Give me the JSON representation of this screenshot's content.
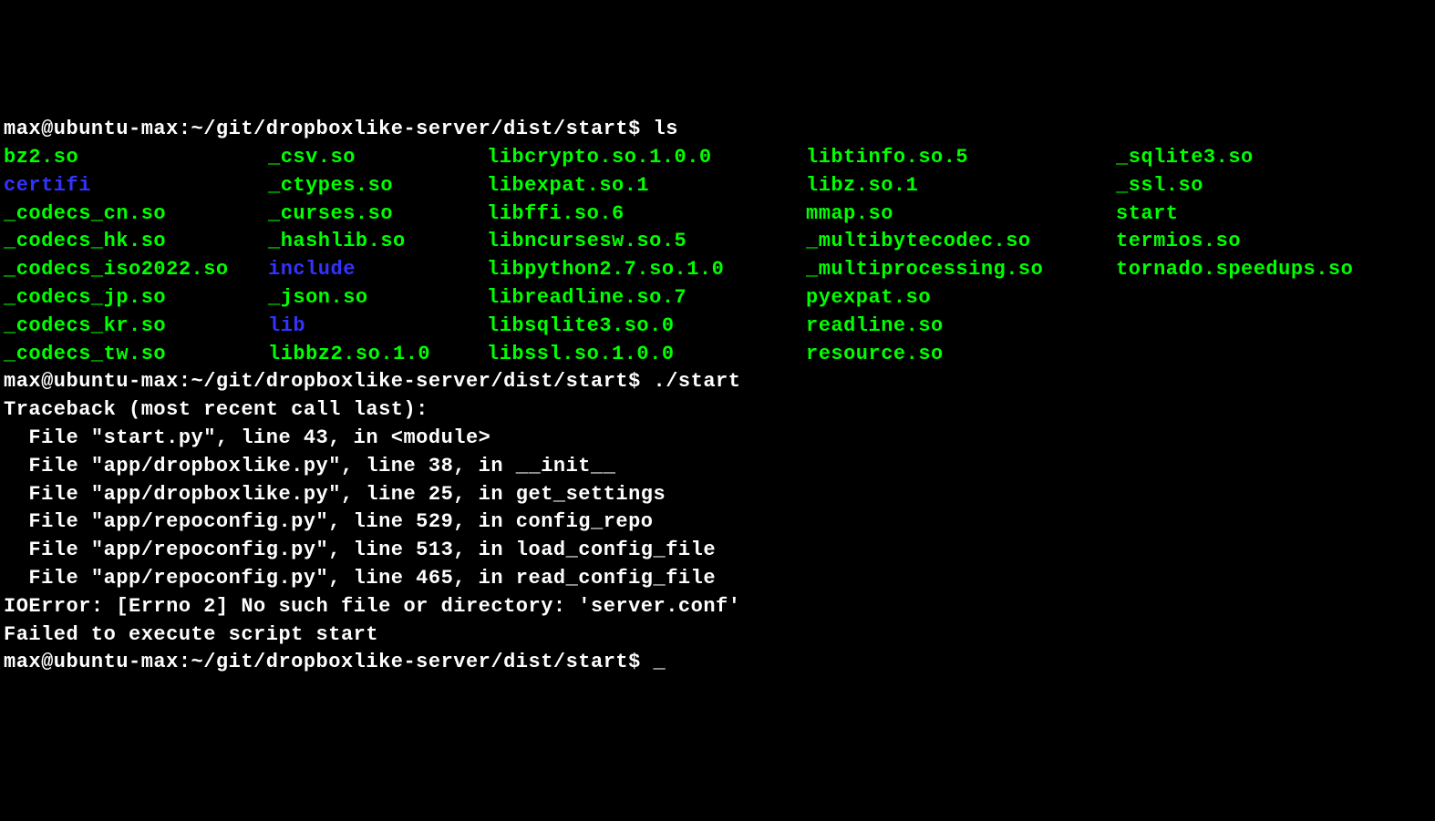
{
  "prompts": {
    "p1_prefix": "max@ubuntu-max:~/git/dropboxlike-server/dist/start$ ",
    "p1_cmd": "ls",
    "p2_prefix": "max@ubuntu-max:~/git/dropboxlike-server/dist/start$ ",
    "p2_cmd": "./start",
    "p3_prefix": "max@ubuntu-max:~/git/dropboxlike-server/dist/start$ "
  },
  "ls": {
    "rows": [
      [
        {
          "name": "bz2.so",
          "type": "file"
        },
        {
          "name": "_csv.so",
          "type": "file"
        },
        {
          "name": "libcrypto.so.1.0.0",
          "type": "file"
        },
        {
          "name": "libtinfo.so.5",
          "type": "file"
        },
        {
          "name": "_sqlite3.so",
          "type": "file"
        }
      ],
      [
        {
          "name": "certifi",
          "type": "dir"
        },
        {
          "name": "_ctypes.so",
          "type": "file"
        },
        {
          "name": "libexpat.so.1",
          "type": "file"
        },
        {
          "name": "libz.so.1",
          "type": "file"
        },
        {
          "name": "_ssl.so",
          "type": "file"
        }
      ],
      [
        {
          "name": "_codecs_cn.so",
          "type": "file"
        },
        {
          "name": "_curses.so",
          "type": "file"
        },
        {
          "name": "libffi.so.6",
          "type": "file"
        },
        {
          "name": "mmap.so",
          "type": "file"
        },
        {
          "name": "start",
          "type": "file"
        }
      ],
      [
        {
          "name": "_codecs_hk.so",
          "type": "file"
        },
        {
          "name": "_hashlib.so",
          "type": "file"
        },
        {
          "name": "libncursesw.so.5",
          "type": "file"
        },
        {
          "name": "_multibytecodec.so",
          "type": "file"
        },
        {
          "name": "termios.so",
          "type": "file"
        }
      ],
      [
        {
          "name": "_codecs_iso2022.so",
          "type": "file"
        },
        {
          "name": "include",
          "type": "dir"
        },
        {
          "name": "libpython2.7.so.1.0",
          "type": "file"
        },
        {
          "name": "_multiprocessing.so",
          "type": "file"
        },
        {
          "name": "tornado.speedups.so",
          "type": "file"
        }
      ],
      [
        {
          "name": "_codecs_jp.so",
          "type": "file"
        },
        {
          "name": "_json.so",
          "type": "file"
        },
        {
          "name": "libreadline.so.7",
          "type": "file"
        },
        {
          "name": "pyexpat.so",
          "type": "file"
        },
        {
          "name": "",
          "type": "empty"
        }
      ],
      [
        {
          "name": "_codecs_kr.so",
          "type": "file"
        },
        {
          "name": "lib",
          "type": "dir"
        },
        {
          "name": "libsqlite3.so.0",
          "type": "file"
        },
        {
          "name": "readline.so",
          "type": "file"
        },
        {
          "name": "",
          "type": "empty"
        }
      ],
      [
        {
          "name": "_codecs_tw.so",
          "type": "file"
        },
        {
          "name": "libbz2.so.1.0",
          "type": "file"
        },
        {
          "name": "libssl.so.1.0.0",
          "type": "file"
        },
        {
          "name": "resource.so",
          "type": "file"
        },
        {
          "name": "",
          "type": "empty"
        }
      ]
    ]
  },
  "traceback": {
    "lines": [
      "Traceback (most recent call last):",
      "  File \"start.py\", line 43, in <module>",
      "  File \"app/dropboxlike.py\", line 38, in __init__",
      "  File \"app/dropboxlike.py\", line 25, in get_settings",
      "  File \"app/repoconfig.py\", line 529, in config_repo",
      "  File \"app/repoconfig.py\", line 513, in load_config_file",
      "  File \"app/repoconfig.py\", line 465, in read_config_file",
      "IOError: [Errno 2] No such file or directory: 'server.conf'",
      "Failed to execute script start"
    ]
  }
}
